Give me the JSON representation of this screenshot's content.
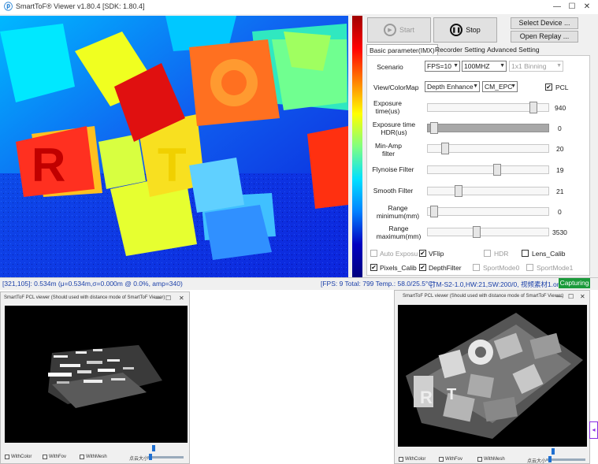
{
  "app": {
    "title": "SmartToF® Viewer v1.80.4 [SDK: 1.80.4]",
    "icon": "tof-logo-icon"
  },
  "window_controls": {
    "minimize": "—",
    "maximize": "☐",
    "close": "✕"
  },
  "toolbar": {
    "start_label": "Start",
    "stop_label": "Stop",
    "select_device_label": "Select Device ...",
    "open_replay_label": "Open Replay ..."
  },
  "tabs": [
    {
      "label": "Basic parameter(IMX)",
      "active": true
    },
    {
      "label": "Recorder Setting",
      "active": false
    },
    {
      "label": "Advanced Setting",
      "active": false
    }
  ],
  "basic": {
    "scenario_label": "Scenario",
    "fps_value": "FPS=10",
    "freq_value": "100MHZ",
    "binning_value": "1x1 Binning",
    "view_label": "View/ColorMap",
    "view_value": "Depth Enhance",
    "colormap_value": "CM_EPC",
    "pcl_label": "PCL",
    "sliders": [
      {
        "label": "Exposure time(us)",
        "value": "940",
        "level": 0.9
      },
      {
        "label": "Exposure time HDR(us)",
        "value": "0",
        "level": 0.02
      },
      {
        "label": "Min-Amp filter",
        "value": "20",
        "level": 0.12
      },
      {
        "label": "Flynoise Filter",
        "value": "19",
        "level": 0.58
      },
      {
        "label": "Smooth Filter",
        "value": "21",
        "level": 0.24
      },
      {
        "label": "Range minimum(mm)",
        "value": "0",
        "level": 0.02
      },
      {
        "label": "Range maximum(mm)",
        "value": "3530",
        "level": 0.4
      }
    ],
    "checkboxes": [
      {
        "label": "Auto Exposu",
        "checked": false,
        "disabled": true
      },
      {
        "label": "VFlip",
        "checked": true,
        "disabled": false
      },
      {
        "label": "HDR",
        "checked": false,
        "disabled": true
      },
      {
        "label": "Lens_Calib",
        "checked": false,
        "disabled": false
      },
      {
        "label": "Pixels_Calib",
        "checked": true,
        "disabled": false
      },
      {
        "label": "DepthFilter",
        "checked": true,
        "disabled": false
      },
      {
        "label": "SportMode0",
        "checked": false,
        "disabled": true
      },
      {
        "label": "SportMode1",
        "checked": false,
        "disabled": true
      }
    ]
  },
  "status": {
    "cursor_info": "[321,105]: 0.534m (μ=0.534m,σ=0.000m @ 0.0%, amp=340)",
    "fps_info": "[FPS: 9 Total: 799 Temp.: 58.0/25.5°C]",
    "device_info": "[TM-S2-1.0,HW:21,SW:200/0, 视频素材1.oni]",
    "capture_state": "Capturing"
  },
  "pcl_viewers": [
    {
      "title": "SmartToF PCL viewer (Should used with distance mode of SmartToF Viewer)",
      "options": [
        "WithColor",
        "WithFov",
        "WithMesh",
        "点云大小"
      ],
      "checked": [
        true,
        false,
        false
      ]
    },
    {
      "title": "SmartToF PCL viewer (Should used with distance mode of SmartToF Viewer)",
      "options": [
        "WithColor",
        "WithFov",
        "WithMesh",
        "点云大小"
      ],
      "checked": [
        true,
        false,
        false
      ]
    }
  ],
  "colors": {
    "accent": "#1f7fd4",
    "status_text": "#1a3fa8",
    "capturing_bg": "#1a9a3a",
    "depth_background": "#1030d8"
  }
}
